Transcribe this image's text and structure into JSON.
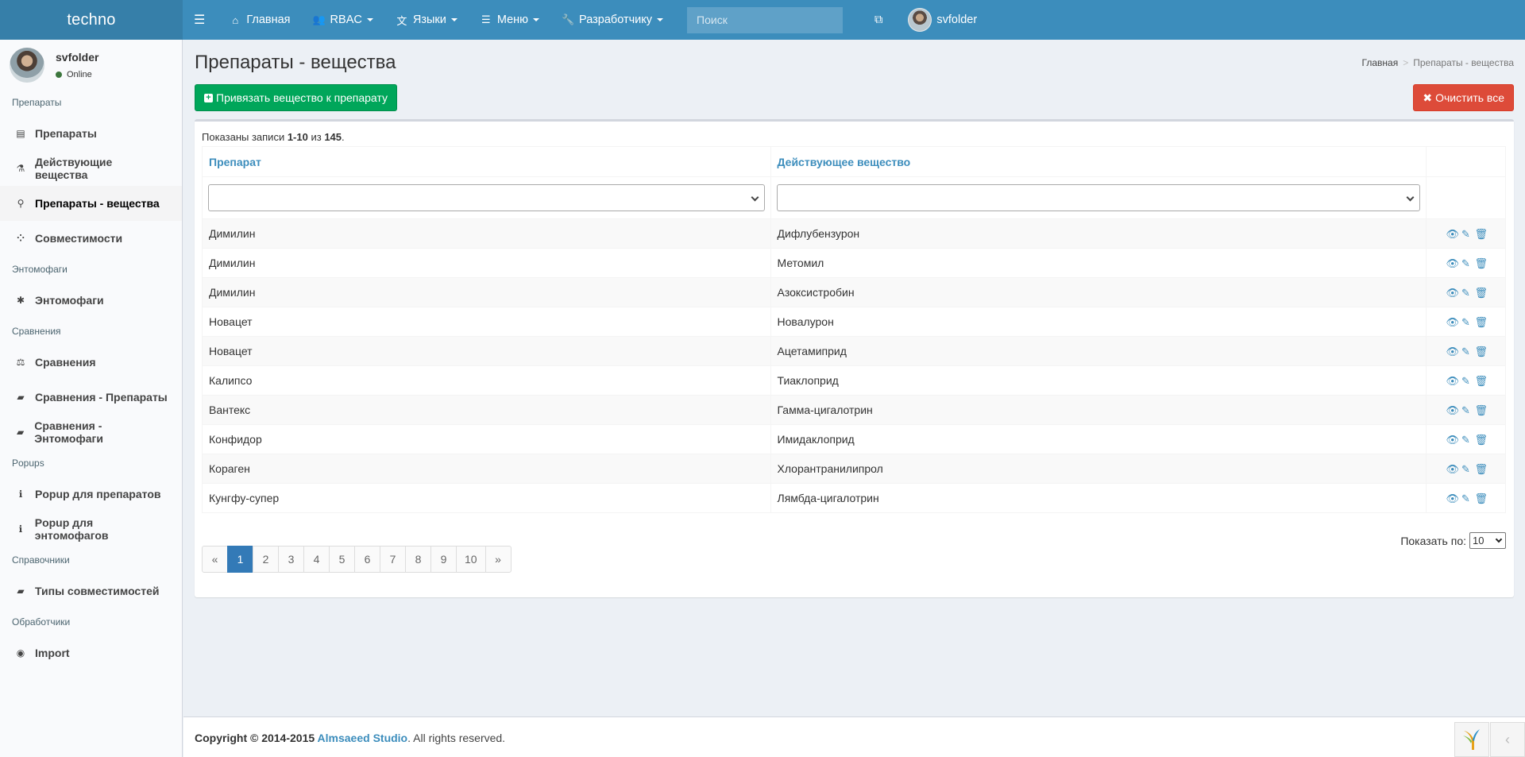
{
  "app": {
    "logo": "techno"
  },
  "topnav": {
    "home": "Главная",
    "rbac": "RBAC",
    "languages": "Языки",
    "menu": "Меню",
    "developer": "Разработчику",
    "search_placeholder": "Поиск",
    "user": "svfolder"
  },
  "sidebar": {
    "user": {
      "name": "svfolder",
      "status": "Online"
    },
    "sections": [
      {
        "title": "Препараты",
        "items": [
          {
            "label": "Препараты",
            "icon": "ticket-icon"
          },
          {
            "label": "Действующие вещества",
            "icon": "flask-icon"
          },
          {
            "label": "Препараты - вещества",
            "icon": "share-icon",
            "active": true
          },
          {
            "label": "Совместимости",
            "icon": "cubes-icon"
          }
        ]
      },
      {
        "title": "Энтомофаги",
        "items": [
          {
            "label": "Энтомофаги",
            "icon": "bug-icon"
          }
        ]
      },
      {
        "title": "Сравнения",
        "items": [
          {
            "label": "Сравнения",
            "icon": "balance-icon"
          },
          {
            "label": "Сравнения - Препараты",
            "icon": "book-icon"
          },
          {
            "label": "Сравнения - Энтомофаги",
            "icon": "book-icon"
          }
        ]
      },
      {
        "title": "Popups",
        "items": [
          {
            "label": "Popup для препаратов",
            "icon": "info-icon"
          },
          {
            "label": "Popup для энтомофагов",
            "icon": "info-icon"
          }
        ]
      },
      {
        "title": "Справочники",
        "items": [
          {
            "label": "Типы совместимостей",
            "icon": "book-icon"
          }
        ]
      },
      {
        "title": "Обработчики",
        "items": [
          {
            "label": "Import",
            "icon": "import-icon"
          }
        ]
      }
    ]
  },
  "page": {
    "title": "Препараты - вещества",
    "breadcrumb": {
      "home": "Главная",
      "separator": ">",
      "current": "Препараты - вещества"
    },
    "add_button": "Привязать вещество к препарату",
    "clear_button": "Очистить все"
  },
  "grid": {
    "summary": {
      "prefix": "Показаны записи ",
      "range": "1-10",
      "middle": " из ",
      "total": "145",
      "suffix": "."
    },
    "columns": [
      "Препарат",
      "Действующее вещество"
    ],
    "rows": [
      {
        "drug": "Димилин",
        "substance": "Дифлубензурон"
      },
      {
        "drug": "Димилин",
        "substance": "Метомил"
      },
      {
        "drug": "Димилин",
        "substance": "Азоксистробин"
      },
      {
        "drug": "Новацет",
        "substance": "Новалурон"
      },
      {
        "drug": "Новацет",
        "substance": "Ацетамиприд"
      },
      {
        "drug": "Калипсо",
        "substance": "Тиаклоприд"
      },
      {
        "drug": "Вантекс",
        "substance": "Гамма-цигалотрин"
      },
      {
        "drug": "Конфидор",
        "substance": "Имидаклоприд"
      },
      {
        "drug": "Кораген",
        "substance": "Хлорантранилипрол"
      },
      {
        "drug": "Кунгфу-супер",
        "substance": "Лямбда-цигалотрин"
      }
    ],
    "page_size_label": "Показать по:",
    "page_size": "10",
    "pager": {
      "prev": "«",
      "pages": [
        "1",
        "2",
        "3",
        "4",
        "5",
        "6",
        "7",
        "8",
        "9",
        "10"
      ],
      "active": "1",
      "next": "»"
    }
  },
  "footer": {
    "copyright": "Copyright © 2014-2015 ",
    "brand": "Almsaeed Studio",
    "rights": ". All rights reserved.",
    "collapse_arrow": "‹"
  },
  "colors": {
    "header": "#3c8dbc",
    "logo_bg": "#367fa9",
    "success": "#00a65a",
    "danger": "#dd4b39",
    "pager_active": "#337ab7"
  }
}
